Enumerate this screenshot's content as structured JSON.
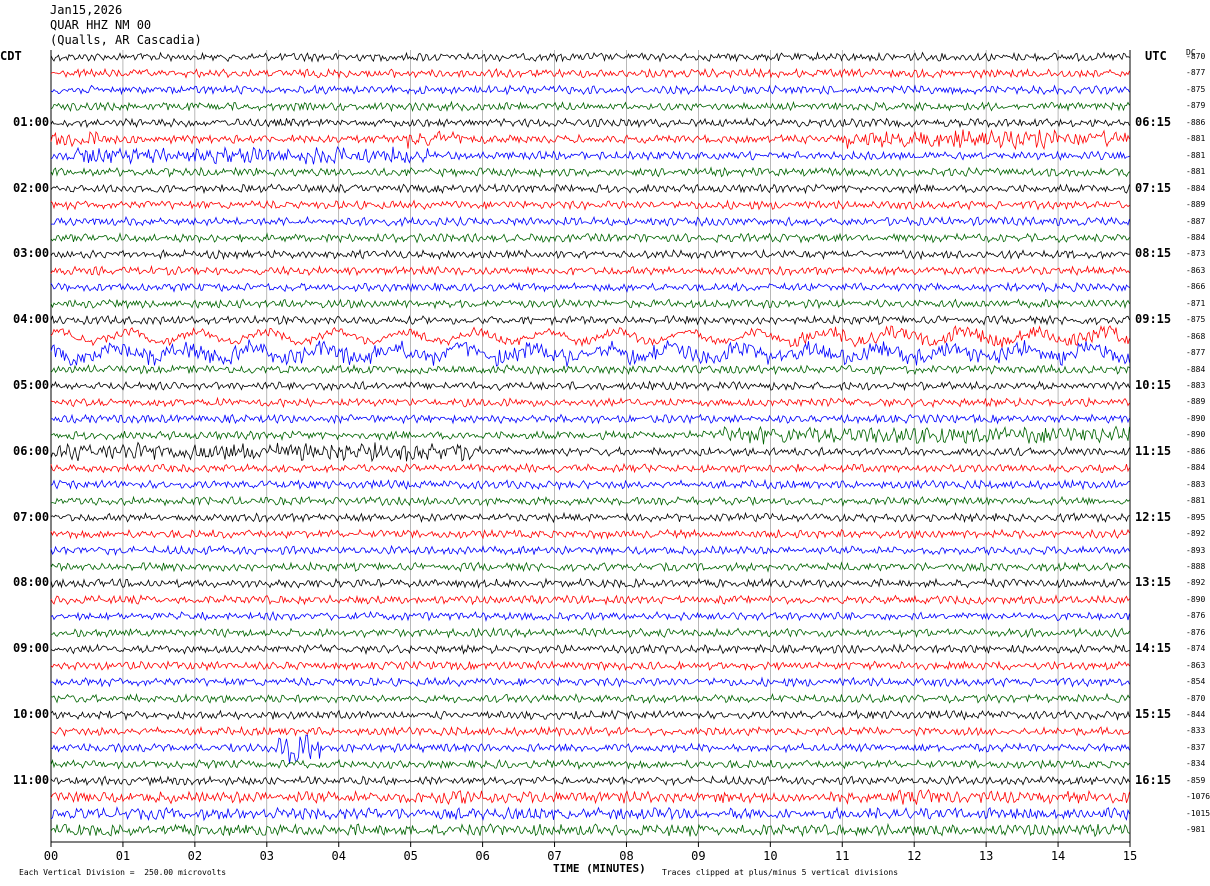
{
  "header": {
    "date": "Jan15,2026",
    "station": "QUAR HHZ NM 00",
    "location": "(Qualls, AR Cascadia)"
  },
  "left_tz": "CDT",
  "right_tz": "UTC",
  "dc_header": "DC",
  "left_hours": [
    "01:00",
    "02:00",
    "03:00",
    "04:00",
    "05:00",
    "06:00",
    "07:00",
    "08:00",
    "09:00",
    "10:00",
    "11:00"
  ],
  "right_hours": [
    "06:15",
    "07:15",
    "08:15",
    "09:15",
    "10:15",
    "11:15",
    "12:15",
    "13:15",
    "14:15",
    "15:15",
    "16:15"
  ],
  "dc_offsets": [
    "-870",
    "-877",
    "-875",
    "-879",
    "-886",
    "-881",
    "-881",
    "-881",
    "-884",
    "-889",
    "-887",
    "-884",
    "-873",
    "-863",
    "-866",
    "-871",
    "-875",
    "-868",
    "-877",
    "-884",
    "-883",
    "-889",
    "-890",
    "-890",
    "-886",
    "-884",
    "-883",
    "-881",
    "-895",
    "-892",
    "-893",
    "-888",
    "-892",
    "-890",
    "-876",
    "-876",
    "-874",
    "-863",
    "-854",
    "-870",
    "-844",
    "-833",
    "-837",
    "-834",
    "-859",
    "-1076",
    "-1015",
    "-981"
  ],
  "x_ticks": [
    "00",
    "01",
    "02",
    "03",
    "04",
    "05",
    "06",
    "07",
    "08",
    "09",
    "10",
    "11",
    "12",
    "13",
    "14",
    "15"
  ],
  "x_title": "TIME (MINUTES)",
  "footer_left": "Each Vertical Division =  250.00 microvolts",
  "footer_right": "Traces clipped at plus/minus 5 vertical divisions",
  "chart_data": {
    "type": "line",
    "title": "QUAR HHZ NM 00",
    "xlabel": "TIME (MINUTES)",
    "xlim": [
      0,
      15
    ],
    "trace_count": 48,
    "minutes_per_trace": 15,
    "trace_colors": [
      "#000000",
      "#ff0000",
      "#0000ff",
      "#006400"
    ],
    "vertical_division_microvolts": 250.0,
    "clip_divisions": 5,
    "grid": "vertical lines each minute"
  }
}
